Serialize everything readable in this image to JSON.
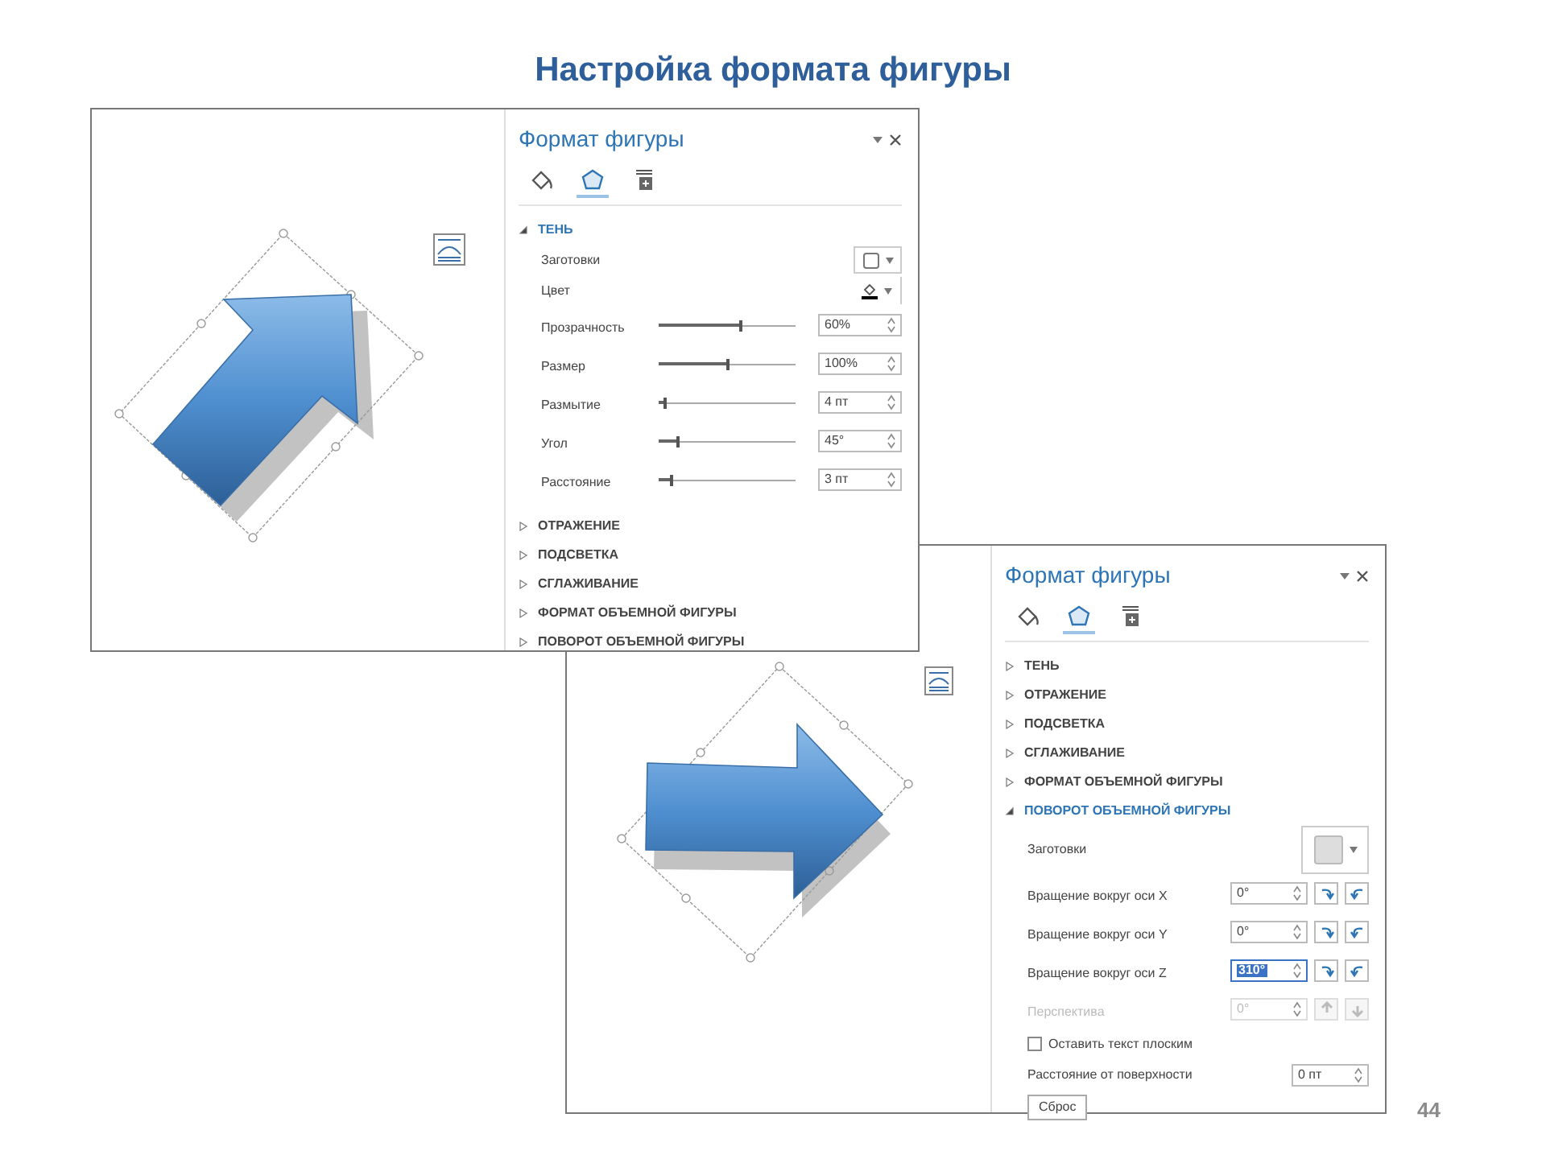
{
  "title": "Настройка формата фигуры",
  "page_number": "44",
  "screenshots": [
    {
      "canvas": {
        "kind": "diagonal"
      },
      "panel": {
        "title": "Формат фигуры",
        "tabs": [
          {
            "kind": "fill",
            "selected": false
          },
          {
            "kind": "effects",
            "selected": true
          },
          {
            "kind": "layout",
            "selected": false
          }
        ],
        "sections": [
          {
            "label": "ТЕНЬ",
            "expanded": true,
            "rows": [
              {
                "kind": "preset",
                "label": "Заготовки"
              },
              {
                "kind": "color",
                "label": "Цвет"
              },
              {
                "kind": "slider",
                "label": "Прозрачность",
                "level": 0.6,
                "value": "60%"
              },
              {
                "kind": "slider",
                "label": "Размер",
                "level": 0.5,
                "value": "100%"
              },
              {
                "kind": "slider",
                "label": "Размытие",
                "level": 0.05,
                "value": "4 пт"
              },
              {
                "kind": "slider",
                "label": "Угол",
                "level": 0.14,
                "value": "45°"
              },
              {
                "kind": "slider",
                "label": "Расстояние",
                "level": 0.09,
                "value": "3 пт"
              }
            ]
          },
          {
            "label": "ОТРАЖЕНИЕ",
            "expanded": false
          },
          {
            "label": "ПОДСВЕТКА",
            "expanded": false
          },
          {
            "label": "СГЛАЖИВАНИЕ",
            "expanded": false
          },
          {
            "label": "ФОРМАТ ОБЪЕМНОЙ ФИГУРЫ",
            "expanded": false
          },
          {
            "label": "ПОВОРОТ ОБЪЕМНОЙ ФИГУРЫ",
            "expanded": false
          }
        ]
      }
    },
    {
      "canvas": {
        "kind": "right"
      },
      "panel": {
        "title": "Формат фигуры",
        "tabs": [
          {
            "kind": "fill",
            "selected": false
          },
          {
            "kind": "effects",
            "selected": true
          },
          {
            "kind": "layout",
            "selected": false
          }
        ],
        "sections": [
          {
            "label": "ТЕНЬ",
            "expanded": false
          },
          {
            "label": "ОТРАЖЕНИЕ",
            "expanded": false
          },
          {
            "label": "ПОДСВЕТКА",
            "expanded": false
          },
          {
            "label": "СГЛАЖИВАНИЕ",
            "expanded": false
          },
          {
            "label": "ФОРМАТ ОБЪЕМНОЙ ФИГУРЫ",
            "expanded": false
          },
          {
            "label": "ПОВОРОТ ОБЪЕМНОЙ ФИГУРЫ",
            "expanded": true,
            "rows": [
              {
                "kind": "preset",
                "label": "Заготовки"
              },
              {
                "kind": "rotation",
                "label": "Вращение вокруг оси X",
                "value": "0°",
                "disabled": false,
                "selected": false
              },
              {
                "kind": "rotation",
                "label": "Вращение вокруг оси Y",
                "value": "0°",
                "disabled": false,
                "selected": false
              },
              {
                "kind": "rotation",
                "label": "Вращение вокруг оси Z",
                "value": "310°",
                "disabled": false,
                "selected": true
              },
              {
                "kind": "rotation",
                "label": "Перспектива",
                "value": "0°",
                "disabled": true,
                "selected": false
              },
              {
                "kind": "checkbox",
                "label": "Оставить текст плоским",
                "checked": false
              },
              {
                "kind": "spin",
                "label": "Расстояние от поверхности",
                "value": "0 пт"
              },
              {
                "kind": "button",
                "label": "Сброс"
              }
            ]
          }
        ]
      }
    }
  ]
}
